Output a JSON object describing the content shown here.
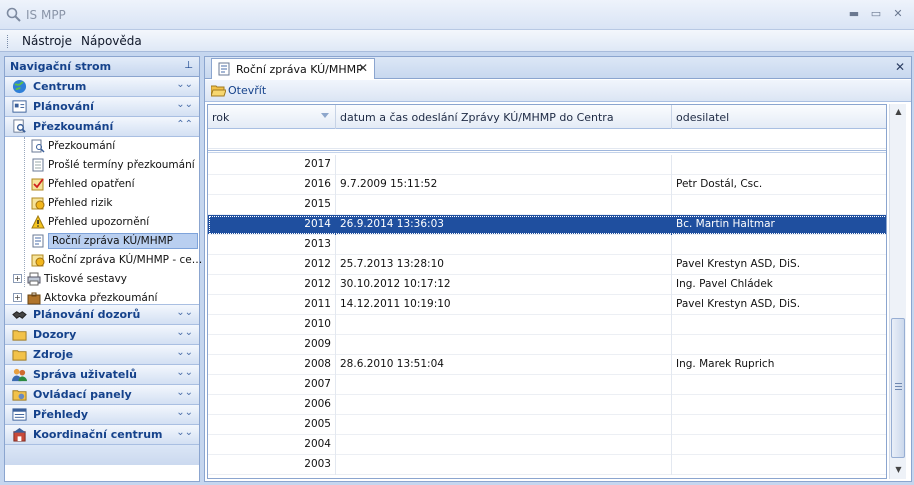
{
  "window": {
    "title": "IS MPP",
    "minimize_glyph": "▬",
    "maximize_glyph": "▭",
    "close_glyph": "✕"
  },
  "menu": {
    "items": [
      "Nástroje",
      "Nápověda"
    ]
  },
  "nav": {
    "header": "Navigační strom",
    "pin_glyph": "⊥",
    "groups_top": [
      {
        "label": "Centrum",
        "icon": "globe-icon",
        "state": "collapsed"
      },
      {
        "label": "Plánování",
        "icon": "planning-icon",
        "state": "collapsed"
      },
      {
        "label": "Přezkoumání",
        "icon": "review-icon",
        "state": "expanded"
      }
    ],
    "tree_items": [
      {
        "label": "Přezkoumání",
        "icon": "review-doc-icon"
      },
      {
        "label": "Prošlé termíny přezkoumání",
        "icon": "document-icon"
      },
      {
        "label": "Přehled opatření",
        "icon": "checklist-icon"
      },
      {
        "label": "Přehled rizik",
        "icon": "risk-icon"
      },
      {
        "label": "Přehled upozornění",
        "icon": "warning-icon"
      },
      {
        "label": "Roční zpráva KÚ/MHMP",
        "icon": "report-icon",
        "selected": true
      },
      {
        "label": "Roční zpráva KÚ/MHMP - ce…",
        "icon": "report-summary-icon"
      },
      {
        "label": "Tiskové sestavy",
        "icon": "printer-icon",
        "expander": "+"
      },
      {
        "label": "Aktovka přezkoumání",
        "icon": "briefcase-icon",
        "expander": "+"
      }
    ],
    "groups_bottom": [
      {
        "label": "Plánování dozorů",
        "icon": "handshake-icon"
      },
      {
        "label": "Dozory",
        "icon": "folder-icon"
      },
      {
        "label": "Zdroje",
        "icon": "folder-icon"
      },
      {
        "label": "Správa uživatelů",
        "icon": "users-icon"
      },
      {
        "label": "Ovládací panely",
        "icon": "control-panel-icon"
      },
      {
        "label": "Přehledy",
        "icon": "overview-icon"
      },
      {
        "label": "Koordinační centrum",
        "icon": "building-icon"
      }
    ]
  },
  "document": {
    "tab_label": "Roční zpráva KÚ/MHMP",
    "tab_close_glyph": "✕",
    "close_glyph": "✕",
    "toolbar": {
      "open_label": "Otevřít"
    },
    "grid": {
      "columns": [
        "rok",
        "datum a čas odeslání Zprávy KÚ/MHMP do Centra",
        "odesilatel"
      ],
      "rows": [
        {
          "rok": "2017",
          "datum": "",
          "odesilatel": ""
        },
        {
          "rok": "2016",
          "datum": "9.7.2009 15:11:52",
          "odesilatel": "Petr Dostál, Csc."
        },
        {
          "rok": "2015",
          "datum": "",
          "odesilatel": ""
        },
        {
          "rok": "2014",
          "datum": "26.9.2014 13:36:03",
          "odesilatel": "Bc. Martin Haltmar",
          "selected": true
        },
        {
          "rok": "2013",
          "datum": "",
          "odesilatel": ""
        },
        {
          "rok": "2012",
          "datum": "25.7.2013 13:28:10",
          "odesilatel": "Pavel Krestyn ASD, DiS."
        },
        {
          "rok": "2012",
          "datum": "30.10.2012 10:17:12",
          "odesilatel": "Ing. Pavel Chládek"
        },
        {
          "rok": "2011",
          "datum": "14.12.2011 10:19:10",
          "odesilatel": "Pavel Krestyn ASD, DiS."
        },
        {
          "rok": "2010",
          "datum": "",
          "odesilatel": ""
        },
        {
          "rok": "2009",
          "datum": "",
          "odesilatel": ""
        },
        {
          "rok": "2008",
          "datum": "28.6.2010 13:51:04",
          "odesilatel": "Ing. Marek Ruprich"
        },
        {
          "rok": "2007",
          "datum": "",
          "odesilatel": ""
        },
        {
          "rok": "2006",
          "datum": "",
          "odesilatel": ""
        },
        {
          "rok": "2005",
          "datum": "",
          "odesilatel": ""
        },
        {
          "rok": "2004",
          "datum": "",
          "odesilatel": ""
        },
        {
          "rok": "2003",
          "datum": "",
          "odesilatel": ""
        }
      ]
    },
    "scrollbar": {
      "up_glyph": "▲",
      "down_glyph": "▼"
    }
  }
}
